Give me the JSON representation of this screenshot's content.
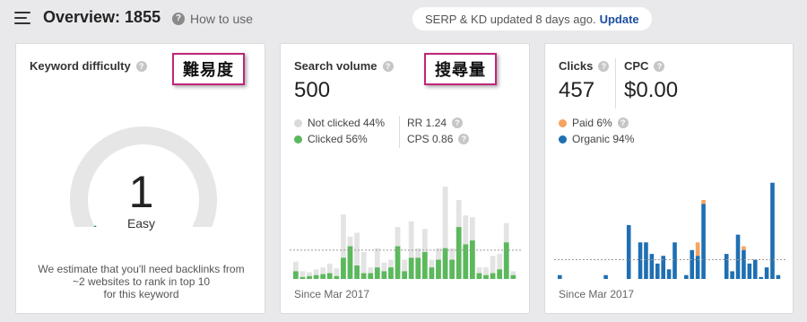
{
  "header": {
    "title": "Overview: 1855",
    "how_to": "How to use",
    "update_text": "SERP & KD updated 8 days ago.",
    "update_link": "Update"
  },
  "help_glyph": "?",
  "kd": {
    "label": "Keyword difficulty",
    "annotation": "難易度",
    "value": "1",
    "level": "Easy",
    "value_fraction": 0.01,
    "desc": [
      "We estimate that you'll need backlinks from",
      "~2 websites to rank in top 10",
      "for this keyword"
    ],
    "colors": {
      "track": "#e6e6e6",
      "indicator": "#1d9a55"
    }
  },
  "sv": {
    "label": "Search volume",
    "annotation": "搜尋量",
    "value": "500",
    "legend": [
      {
        "label": "Not clicked 44%",
        "color": "#d9d9d9"
      },
      {
        "label": "Clicked 56%",
        "color": "#5cb85c"
      }
    ],
    "rr": "RR 1.24",
    "cps": "CPS 0.86",
    "since": "Since Mar 2017"
  },
  "cl": {
    "clicks_label": "Clicks",
    "clicks_value": "457",
    "cpc_label": "CPC",
    "cpc_value": "$0.00",
    "legend": [
      {
        "label": "Paid 6%",
        "color": "#f4a460"
      },
      {
        "label": "Organic 94%",
        "color": "#1f6fb2"
      }
    ],
    "since": "Since Mar 2017"
  },
  "chart_data": [
    {
      "type": "bar",
      "stacked": true,
      "colors": {
        "Clicked": "#5cb85c",
        "Not clicked": "#e3e3e3"
      },
      "average_line": 30,
      "ylim": [
        0,
        110
      ],
      "series": [
        {
          "name": "Clicked",
          "values": [
            8,
            2,
            3,
            4,
            5,
            6,
            3,
            22,
            34,
            14,
            6,
            6,
            12,
            8,
            12,
            34,
            8,
            22,
            22,
            28,
            12,
            20,
            32,
            20,
            54,
            36,
            40,
            6,
            4,
            6,
            10,
            38,
            4
          ]
        },
        {
          "name": "Not clicked",
          "values": [
            10,
            6,
            4,
            6,
            7,
            10,
            8,
            45,
            10,
            34,
            22,
            6,
            20,
            9,
            8,
            20,
            12,
            38,
            10,
            24,
            8,
            12,
            64,
            12,
            28,
            30,
            24,
            6,
            8,
            18,
            16,
            20,
            4
          ]
        }
      ]
    },
    {
      "type": "bar",
      "stacked": true,
      "colors": {
        "Organic": "#1f6fb2",
        "Paid": "#f4a460"
      },
      "average_line": 20,
      "ylim": [
        0,
        110
      ],
      "series": [
        {
          "name": "Organic",
          "values": [
            4,
            0,
            0,
            0,
            0,
            0,
            0,
            0,
            4,
            0,
            0,
            0,
            56,
            0,
            38,
            38,
            26,
            16,
            24,
            10,
            38,
            0,
            4,
            30,
            24,
            78,
            0,
            0,
            0,
            26,
            8,
            46,
            30,
            16,
            20,
            2,
            12,
            100,
            4
          ]
        },
        {
          "name": "Paid",
          "values": [
            0,
            0,
            0,
            0,
            0,
            0,
            0,
            0,
            0,
            0,
            0,
            0,
            0,
            0,
            0,
            0,
            0,
            0,
            0,
            0,
            0,
            0,
            0,
            0,
            14,
            4,
            0,
            0,
            0,
            0,
            0,
            0,
            4,
            0,
            0,
            0,
            0,
            0,
            0
          ]
        }
      ]
    }
  ]
}
